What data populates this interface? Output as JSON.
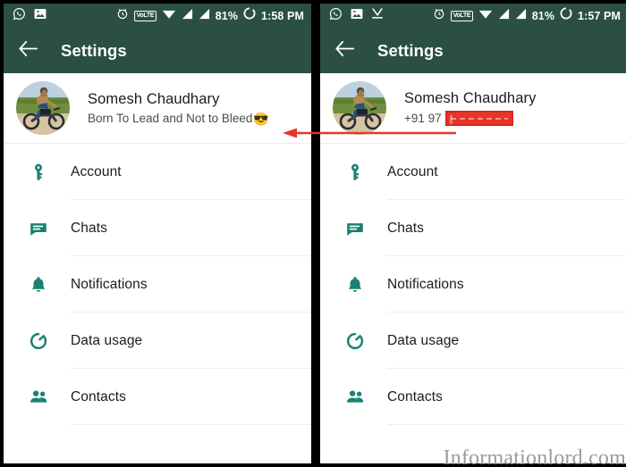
{
  "panels": {
    "left": {
      "statusbar": {
        "time": "1:58 PM",
        "battery": "81%",
        "network_badge": "VoLTE",
        "icons": [
          "whatsapp-icon",
          "image-icon",
          "alarm-icon",
          "volte-badge",
          "wifi-icon",
          "signal-icon-1",
          "signal-icon-2",
          "battery-ring-icon"
        ]
      },
      "appbar": {
        "title": "Settings",
        "back_icon": "back-arrow-icon"
      },
      "profile": {
        "name": "Somesh Chaudhary",
        "subtitle": "Born To Lead and Not to Bleed",
        "subtitle_emoji": "😎",
        "avatar_alt": "man-on-motorcycle-photo"
      }
    },
    "right": {
      "statusbar": {
        "time": "1:57 PM",
        "battery": "81%",
        "network_badge": "VoLTE",
        "icons": [
          "whatsapp-icon",
          "image-icon",
          "download-complete-icon",
          "alarm-icon",
          "volte-badge",
          "wifi-icon",
          "signal-icon-1",
          "signal-icon-2",
          "battery-ring-icon"
        ]
      },
      "appbar": {
        "title": "Settings",
        "back_icon": "back-arrow-icon"
      },
      "profile": {
        "name": "Somesh Chaudhary",
        "subtitle": "+91 97",
        "subtitle_redacted": true,
        "avatar_alt": "man-on-motorcycle-photo"
      }
    }
  },
  "settings_list": [
    {
      "label": "Account",
      "icon": "key-icon"
    },
    {
      "label": "Chats",
      "icon": "chat-bubble-icon"
    },
    {
      "label": "Notifications",
      "icon": "bell-icon"
    },
    {
      "label": "Data usage",
      "icon": "data-usage-icon"
    },
    {
      "label": "Contacts",
      "icon": "contacts-icon"
    }
  ],
  "annotation": {
    "type": "arrow",
    "direction": "right-to-left",
    "color": "#e8352a",
    "description": "red arrow pointing from phone number to status text"
  },
  "watermark": {
    "text": "Informationlord.com"
  },
  "colors": {
    "appbar": "#2b4f44",
    "statusbar": "#2b4f44",
    "icon_accent": "#1a8271",
    "annotation_red": "#e8352a",
    "panel_bg": "#ffffff",
    "divider": "#eeeeee",
    "text_primary": "#1c1c1c",
    "text_secondary": "#4c4c4c"
  }
}
